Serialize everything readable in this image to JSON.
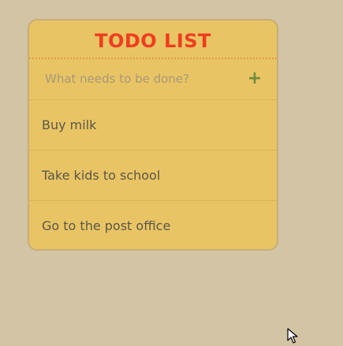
{
  "app": {
    "title": "TODO LIST"
  },
  "new_todo": {
    "placeholder": "What needs to be done?",
    "value": "",
    "add_label": "+"
  },
  "todos": [
    {
      "label": "Buy milk"
    },
    {
      "label": "Take kids to school"
    },
    {
      "label": "Go to the post office"
    }
  ],
  "colors": {
    "background": "#d3c4a5",
    "card": "#e8c464",
    "title": "#ef3d1f",
    "add_button": "#6e8a3e",
    "text": "#5c5648"
  },
  "icons": {
    "cursor": "mouse-pointer-icon"
  }
}
